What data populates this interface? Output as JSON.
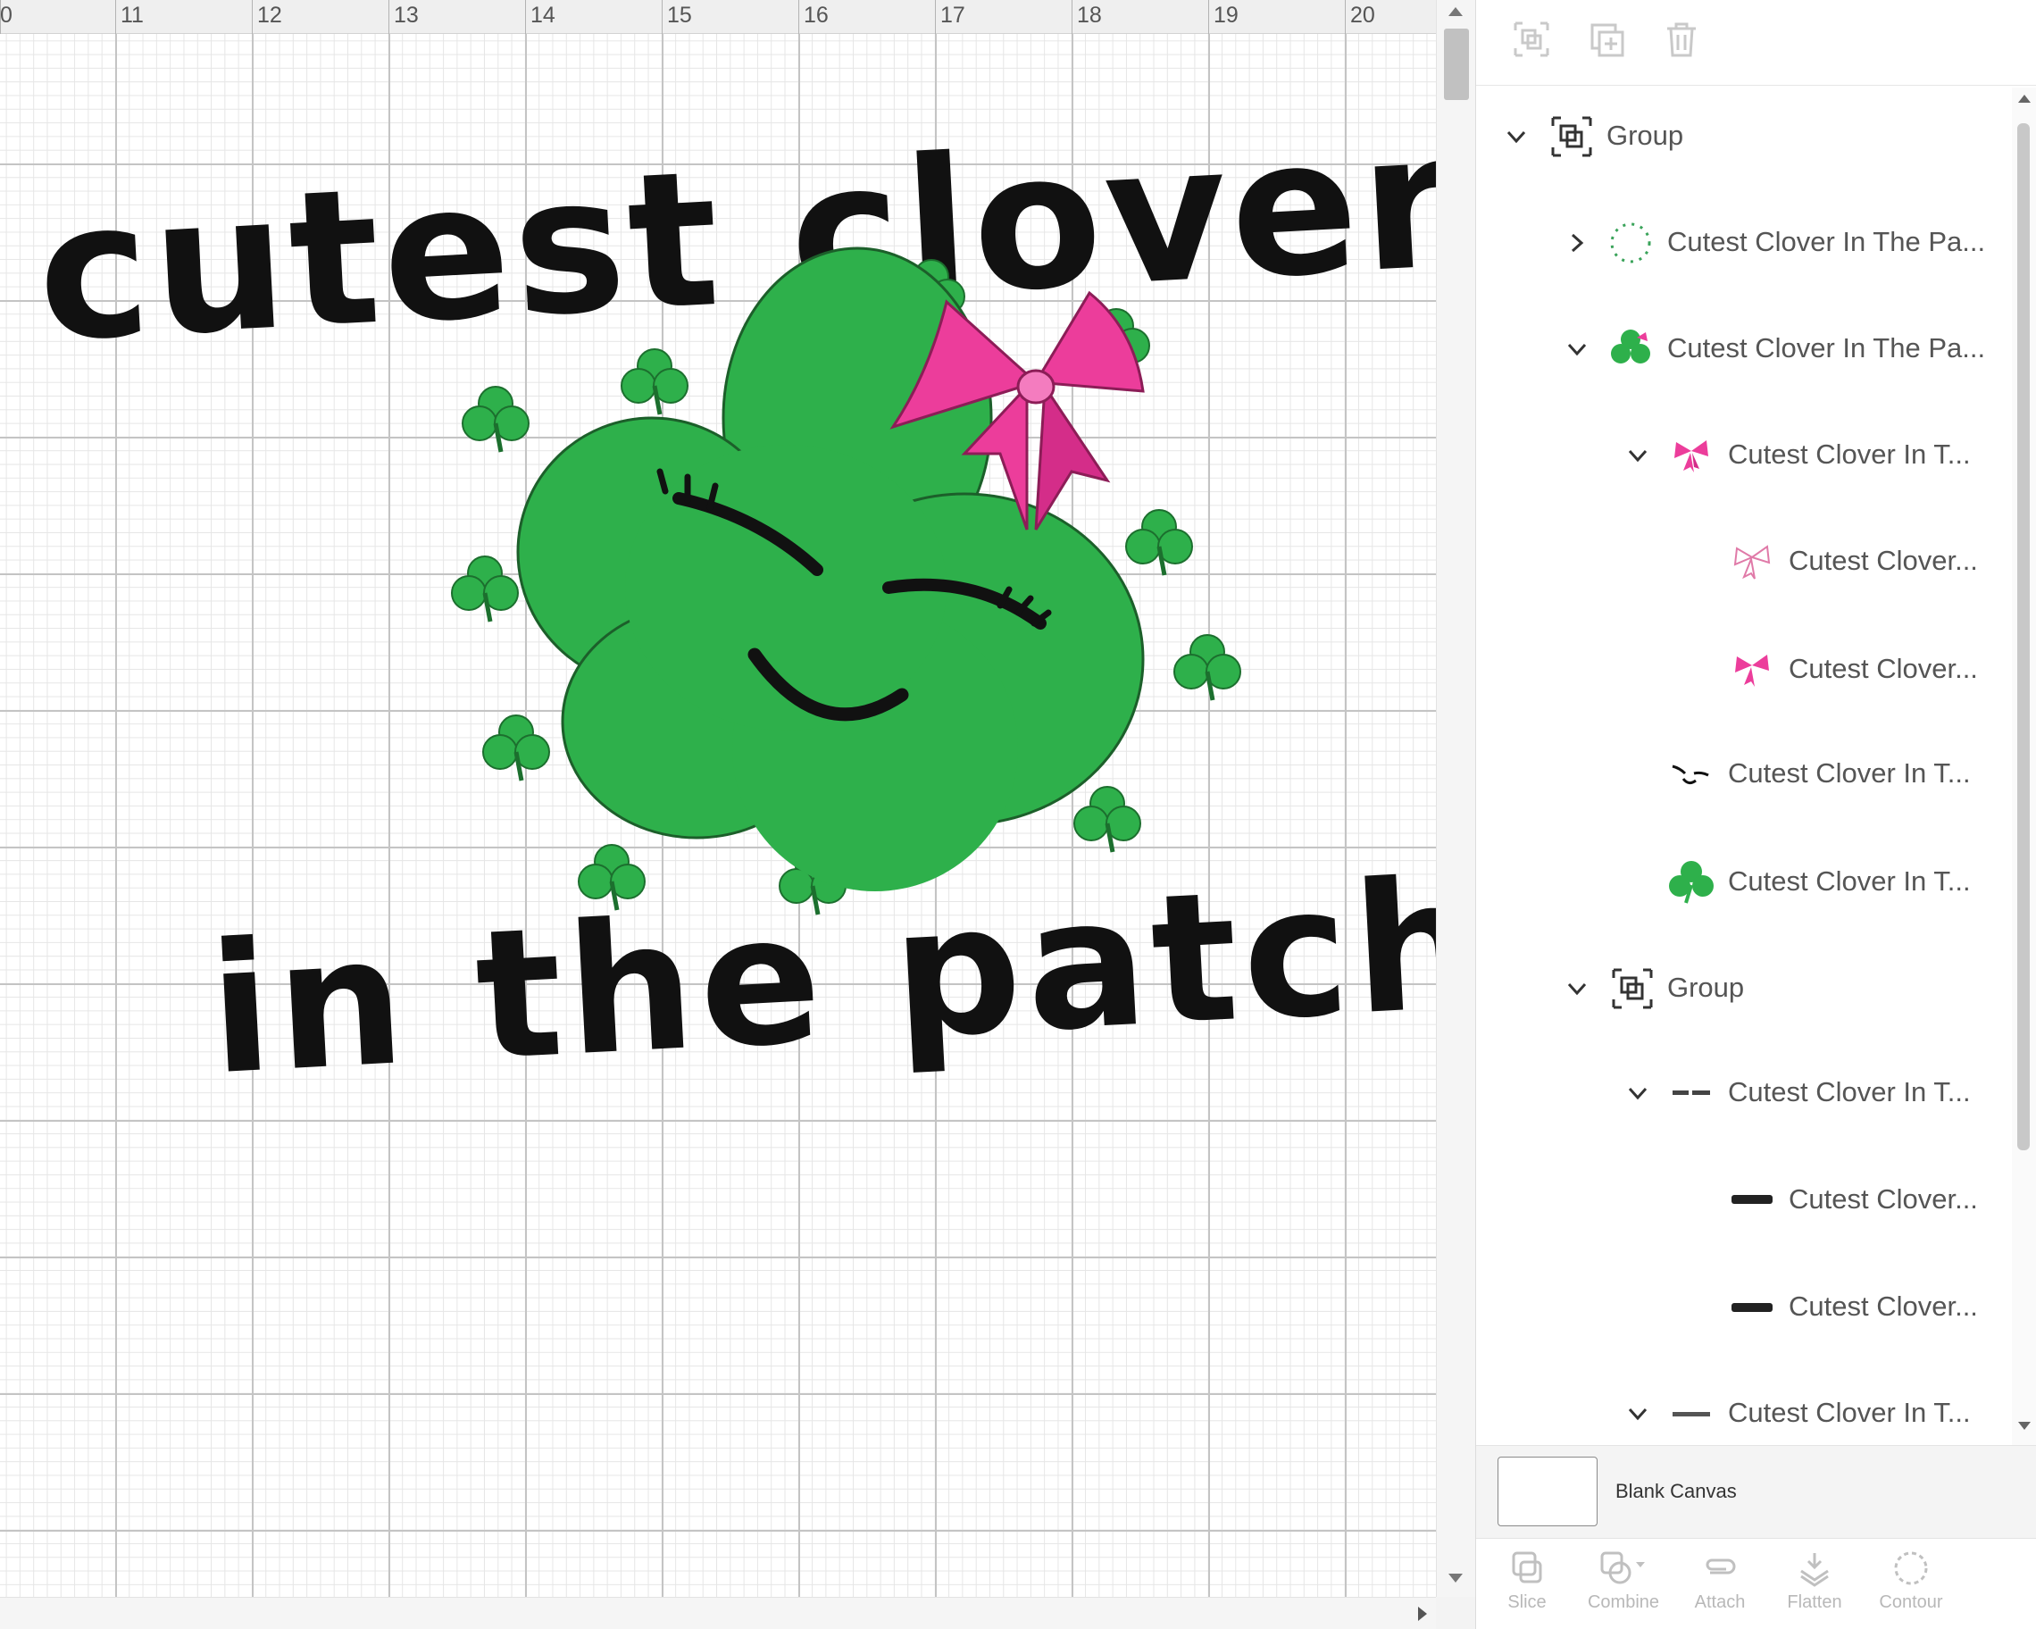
{
  "ruler": {
    "labels": [
      "0",
      "11",
      "12",
      "13",
      "14",
      "15",
      "16",
      "17",
      "18",
      "19",
      "20"
    ]
  },
  "canvas": {
    "artwork_title": "Cutest Clover In The Patch",
    "colors": {
      "clover_green": "#2eb04b",
      "bow_pink": "#ec3d9b",
      "ink_black": "#111111",
      "grid_line": "#c4c4c4"
    }
  },
  "panel": {
    "toolbar_icons": [
      "group-icon",
      "duplicate-icon",
      "delete-icon"
    ],
    "layers": [
      {
        "label": "Group",
        "expanded": true,
        "icon": "group-icon"
      },
      {
        "label": "Cutest Clover In The Pa...",
        "expanded": false,
        "icon": "dotted-outline-thumb"
      },
      {
        "label": "Cutest Clover In The Pa...",
        "expanded": true,
        "icon": "clover-bow-thumb"
      },
      {
        "label": "Cutest Clover In T...",
        "expanded": true,
        "icon": "bow-thumb"
      },
      {
        "label": "Cutest Clover...",
        "icon": "bow-outline-thumb"
      },
      {
        "label": "Cutest Clover...",
        "icon": "bow-thumb"
      },
      {
        "label": "Cutest Clover In T...",
        "icon": "face-thumb"
      },
      {
        "label": "Cutest Clover In T...",
        "icon": "clover-thumb"
      },
      {
        "label": "Group",
        "expanded": true,
        "icon": "group-icon"
      },
      {
        "label": "Cutest Clover In T...",
        "expanded": true,
        "icon": "text-thumb"
      },
      {
        "label": "Cutest Clover...",
        "icon": "clover-word-thumb"
      },
      {
        "label": "Cutest Clover...",
        "icon": "cutest-word-thumb"
      },
      {
        "label": "Cutest Clover In T...",
        "expanded": true,
        "icon": "patch-text-thumb"
      }
    ],
    "canvas_label": "Blank Canvas",
    "bottom_tools": [
      {
        "label": "Slice",
        "icon": "slice-icon"
      },
      {
        "label": "Combine",
        "icon": "combine-icon"
      },
      {
        "label": "Attach",
        "icon": "attach-icon"
      },
      {
        "label": "Flatten",
        "icon": "flatten-icon"
      },
      {
        "label": "Contour",
        "icon": "contour-icon"
      }
    ]
  }
}
